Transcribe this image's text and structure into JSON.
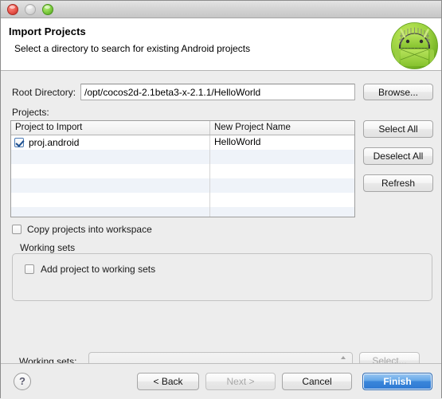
{
  "window": {
    "traffic_lights": [
      "close",
      "minimize",
      "maximize"
    ]
  },
  "header": {
    "title": "Import Projects",
    "subtitle": "Select a directory to search for existing Android projects",
    "logo_icon": "android-robot-icon"
  },
  "form": {
    "root_directory_label": "Root Directory:",
    "root_directory_value": "/opt/cocos2d-2.1beta3-x-2.1.1/HelloWorld",
    "root_directory_placeholder": "",
    "browse_label": "Browse...",
    "projects_label": "Projects:"
  },
  "table": {
    "columns": [
      "Project to Import",
      "New Project Name"
    ],
    "rows": [
      {
        "checked": true,
        "project": "proj.android",
        "new_name": "HelloWorld"
      }
    ],
    "empty_rows": 5
  },
  "side_buttons": {
    "select_all": "Select All",
    "deselect_all": "Deselect All",
    "refresh": "Refresh"
  },
  "options": {
    "copy_projects_label": "Copy projects into workspace",
    "copy_projects_checked": false
  },
  "working_sets": {
    "group_label": "Working sets",
    "add_project_label": "Add project to working sets",
    "add_project_checked": false,
    "working_sets_label": "Working sets:",
    "combo_value": "",
    "select_label": "Select...",
    "select_disabled": true
  },
  "footer": {
    "help_label": "?",
    "back_label": "< Back",
    "next_label": "Next >",
    "next_disabled": true,
    "cancel_label": "Cancel",
    "finish_label": "Finish"
  },
  "colors": {
    "accent": "#3a86da",
    "window_bg": "#ededed",
    "header_bg": "#ffffff",
    "row_alt": "#eff3f9",
    "android_green": "#8fcf3f"
  }
}
